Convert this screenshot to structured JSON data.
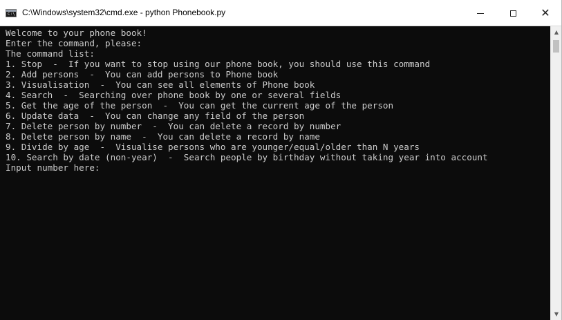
{
  "window": {
    "title": "C:\\Windows\\system32\\cmd.exe - python  Phonebook.py",
    "app_icon_text": "C:\\",
    "minimize_glyph": "—",
    "maximize_glyph": "☐",
    "close_glyph": "✕"
  },
  "console": {
    "lines": [
      "Welcome to your phone book!",
      "Enter the command, please:",
      "The command list:",
      "1. Stop  -  If you want to stop using our phone book, you should use this command",
      "2. Add persons  -  You can add persons to Phone book",
      "3. Visualisation  -  You can see all elements of Phone book",
      "4. Search  -  Searching over phone book by one or several fields",
      "5. Get the age of the person  -  You can get the current age of the person",
      "6. Update data  -  You can change any field of the person",
      "7. Delete person by number  -  You can delete a record by number",
      "8. Delete person by name  -  You can delete a record by name",
      "9. Divide by age  -  Visualise persons who are younger/equal/older than N years",
      "10. Search by date (non-year)  -  Search people by birthday without taking year into account",
      "Input number here: "
    ]
  },
  "scrollbar": {
    "up_glyph": "▲",
    "down_glyph": "▼"
  }
}
